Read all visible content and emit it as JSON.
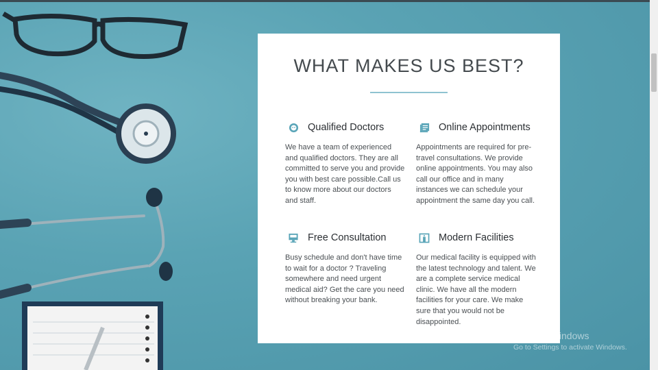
{
  "section": {
    "title": "WHAT MAKES US BEST?"
  },
  "features": [
    {
      "icon": "smiley-face-icon",
      "title": "Qualified Doctors",
      "text": "We have a team of experienced and qualified doctors. They are all committed to serve you and provide you with best care possible.Call us to know more about our doctors and staff."
    },
    {
      "icon": "list-document-icon",
      "title": "Online Appointments",
      "text": "Appointments are required for pre-travel consultations. We provide online appointments. You may also call our office and in many instances we can schedule your appointment the same day you call."
    },
    {
      "icon": "monitor-icon",
      "title": "Free Consultation",
      "text": "Busy schedule and don't have time to wait for a doctor ? Traveling somewhere and need urgent medical aid? Get the care you need without breaking your bank."
    },
    {
      "icon": "building-door-icon",
      "title": "Modern Facilities",
      "text": "Our medical facility is equipped with the latest technology and talent. We are a complete service medical clinic. We have all the modern facilities for your care. We make sure that you would not be disappointed."
    }
  ],
  "watermark": {
    "line1": "Activate Windows",
    "line2": "Go to Settings to activate Windows."
  },
  "colors": {
    "accent": "#5aa5b8",
    "background": "#5c9fae"
  }
}
